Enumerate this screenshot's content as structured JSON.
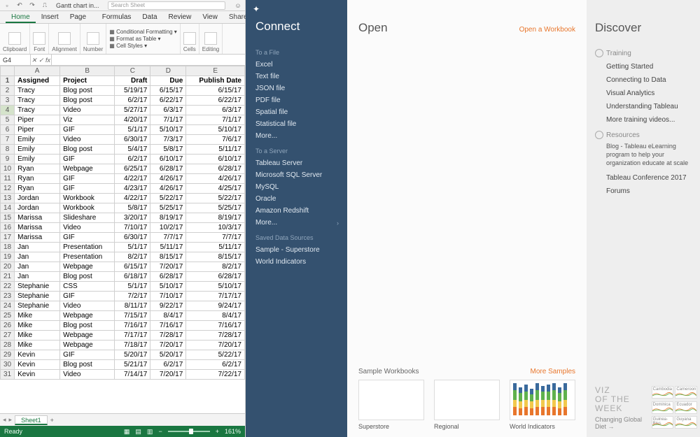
{
  "excel": {
    "titlebar": {
      "doc_title": "Gantt chart in...",
      "search_placeholder": "Search Sheet"
    },
    "tabs": [
      "Home",
      "Insert",
      "Page Layout",
      "Formulas",
      "Data",
      "Review",
      "View"
    ],
    "active_tab": "Home",
    "share_label": "Share",
    "ribbon": {
      "groups": [
        "Clipboard",
        "Font",
        "Alignment",
        "Number",
        "Cells",
        "Editing"
      ],
      "cond_fmt": "Conditional Formatting",
      "fmt_table": "Format as Table",
      "cell_styles": "Cell Styles"
    },
    "namebox": "G4",
    "fx": "fx",
    "columns": [
      "A",
      "B",
      "C",
      "D",
      "E"
    ],
    "headers": [
      "Assigned",
      "Project",
      "Draft",
      "Due",
      "Publish Date"
    ],
    "rows": [
      [
        "Tracy",
        "Blog post",
        "5/19/17",
        "6/15/17",
        "6/15/17"
      ],
      [
        "Tracy",
        "Blog post",
        "6/2/17",
        "6/22/17",
        "6/22/17"
      ],
      [
        "Tracy",
        "Video",
        "5/27/17",
        "6/3/17",
        "6/3/17"
      ],
      [
        "Piper",
        "Viz",
        "4/20/17",
        "7/1/17",
        "7/1/17"
      ],
      [
        "Piper",
        "GIF",
        "5/1/17",
        "5/10/17",
        "5/10/17"
      ],
      [
        "Emily",
        "Video",
        "6/30/17",
        "7/3/17",
        "7/6/17"
      ],
      [
        "Emily",
        "Blog post",
        "5/4/17",
        "5/8/17",
        "5/11/17"
      ],
      [
        "Emily",
        "GIF",
        "6/2/17",
        "6/10/17",
        "6/10/17"
      ],
      [
        "Ryan",
        "Webpage",
        "6/25/17",
        "6/28/17",
        "6/28/17"
      ],
      [
        "Ryan",
        "GIF",
        "4/22/17",
        "4/26/17",
        "4/26/17"
      ],
      [
        "Ryan",
        "GIF",
        "4/23/17",
        "4/26/17",
        "4/25/17"
      ],
      [
        "Jordan",
        "Workbook",
        "4/22/17",
        "5/22/17",
        "5/22/17"
      ],
      [
        "Jordan",
        "Workbook",
        "5/8/17",
        "5/25/17",
        "5/25/17"
      ],
      [
        "Marissa",
        "Slideshare",
        "3/20/17",
        "8/19/17",
        "8/19/17"
      ],
      [
        "Marissa",
        "Video",
        "7/10/17",
        "10/2/17",
        "10/3/17"
      ],
      [
        "Marissa",
        "GIF",
        "6/30/17",
        "7/7/17",
        "7/7/17"
      ],
      [
        "Jan",
        "Presentation",
        "5/1/17",
        "5/11/17",
        "5/11/17"
      ],
      [
        "Jan",
        "Presentation",
        "8/2/17",
        "8/15/17",
        "8/15/17"
      ],
      [
        "Jan",
        "Webpage",
        "6/15/17",
        "7/20/17",
        "8/2/17"
      ],
      [
        "Jan",
        "Blog post",
        "6/18/17",
        "6/28/17",
        "6/28/17"
      ],
      [
        "Stephanie",
        "CSS",
        "5/1/17",
        "5/10/17",
        "5/10/17"
      ],
      [
        "Stephanie",
        "GIF",
        "7/2/17",
        "7/10/17",
        "7/17/17"
      ],
      [
        "Stephanie",
        "Video",
        "8/11/17",
        "9/22/17",
        "9/24/17"
      ],
      [
        "Mike",
        "Webpage",
        "7/15/17",
        "8/4/17",
        "8/4/17"
      ],
      [
        "Mike",
        "Blog post",
        "7/16/17",
        "7/16/17",
        "7/16/17"
      ],
      [
        "Mike",
        "Webpage",
        "7/17/17",
        "7/28/17",
        "7/28/17"
      ],
      [
        "Mike",
        "Webpage",
        "7/18/17",
        "7/20/17",
        "7/20/17"
      ],
      [
        "Kevin",
        "GIF",
        "5/20/17",
        "5/20/17",
        "5/22/17"
      ],
      [
        "Kevin",
        "Blog post",
        "5/21/17",
        "6/2/17",
        "6/2/17"
      ],
      [
        "Kevin",
        "Video",
        "7/14/17",
        "7/20/17",
        "7/22/17"
      ]
    ],
    "selected_row_index": 3,
    "sheet_tab": "Sheet1",
    "status": {
      "ready": "Ready",
      "zoom": "161%"
    }
  },
  "tableau": {
    "connect": {
      "title": "Connect",
      "to_file_label": "To a File",
      "to_file": [
        "Excel",
        "Text file",
        "JSON file",
        "PDF file",
        "Spatial file",
        "Statistical file",
        "More..."
      ],
      "to_server_label": "To a Server",
      "to_server": [
        "Tableau Server",
        "Microsoft SQL Server",
        "MySQL",
        "Oracle",
        "Amazon Redshift",
        "More..."
      ],
      "saved_label": "Saved Data Sources",
      "saved": [
        "Sample - Superstore",
        "World Indicators"
      ]
    },
    "open": {
      "title": "Open",
      "open_workbook": "Open a Workbook",
      "sample_workbooks": "Sample Workbooks",
      "more_samples": "More Samples",
      "samples": [
        "Superstore",
        "Regional",
        "World Indicators"
      ]
    },
    "discover": {
      "title": "Discover",
      "training_label": "Training",
      "training": [
        "Getting Started",
        "Connecting to Data",
        "Visual Analytics",
        "Understanding Tableau",
        "More training videos..."
      ],
      "resources_label": "Resources",
      "blog": "Blog - Tableau eLearning program to help your organization educate at scale",
      "resources": [
        "Tableau Conference 2017",
        "Forums"
      ],
      "votw": {
        "label": "VIZ\nOF THE\nWEEK",
        "sub": "Changing Global Diet",
        "sparks": [
          "Cambodia",
          "Cameroon",
          "Dominica",
          "Ecuador",
          "Guinea-Biss.",
          "Guyana"
        ]
      }
    }
  }
}
